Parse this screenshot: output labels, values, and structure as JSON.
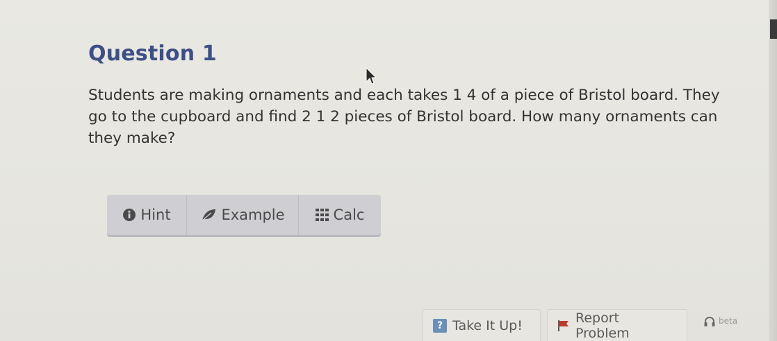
{
  "question": {
    "title": "Question 1",
    "text": "Students are making ornaments and each takes 1 4 of a piece of Bristol board. They go to the cupboard and find 2 1 2 pieces of Bristol board. How many ornaments can they make?"
  },
  "toolbar": {
    "hint_label": "Hint",
    "example_label": "Example",
    "calc_label": "Calc",
    "icons": {
      "hint": "info-icon",
      "example": "leaf-icon",
      "calc": "calculator-grid-icon"
    }
  },
  "footer": {
    "take_it_up_label": "Take It Up!",
    "take_it_up_badge": "?",
    "report_problem_label": "Report Problem",
    "beta_label": "beta",
    "icons": {
      "take_it_up": "question-badge-icon",
      "report": "flag-icon",
      "beta": "headset-icon"
    }
  },
  "colors": {
    "title": "#3e4f86",
    "body_text": "#333333",
    "toolbar_bg": "#cfcfd3",
    "flag": "#c0392b",
    "badge": "#6b8fb8"
  }
}
